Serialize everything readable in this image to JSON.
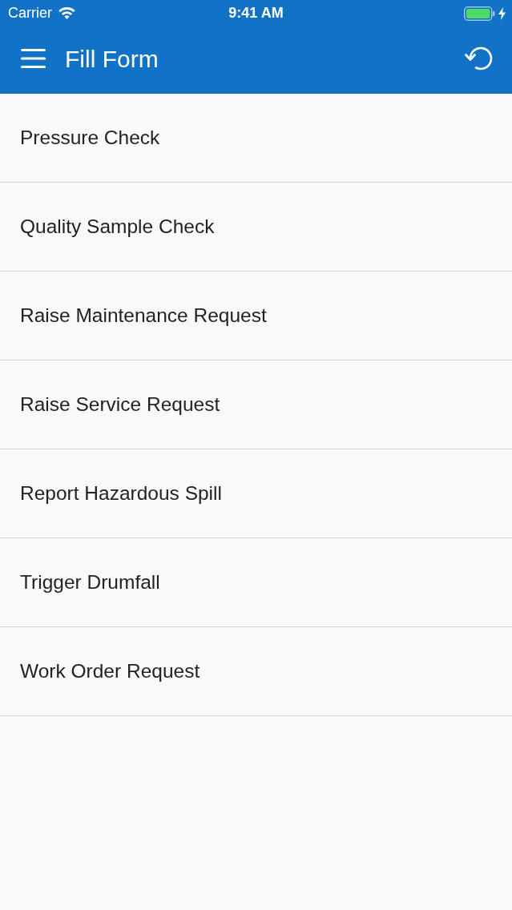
{
  "status_bar": {
    "carrier": "Carrier",
    "time": "9:41 AM"
  },
  "app_bar": {
    "title": "Fill Form"
  },
  "forms": [
    {
      "label": "Pressure Check"
    },
    {
      "label": "Quality Sample Check"
    },
    {
      "label": "Raise Maintenance Request"
    },
    {
      "label": "Raise Service Request"
    },
    {
      "label": "Report Hazardous Spill"
    },
    {
      "label": "Trigger Drumfall"
    },
    {
      "label": "Work Order Request"
    }
  ]
}
